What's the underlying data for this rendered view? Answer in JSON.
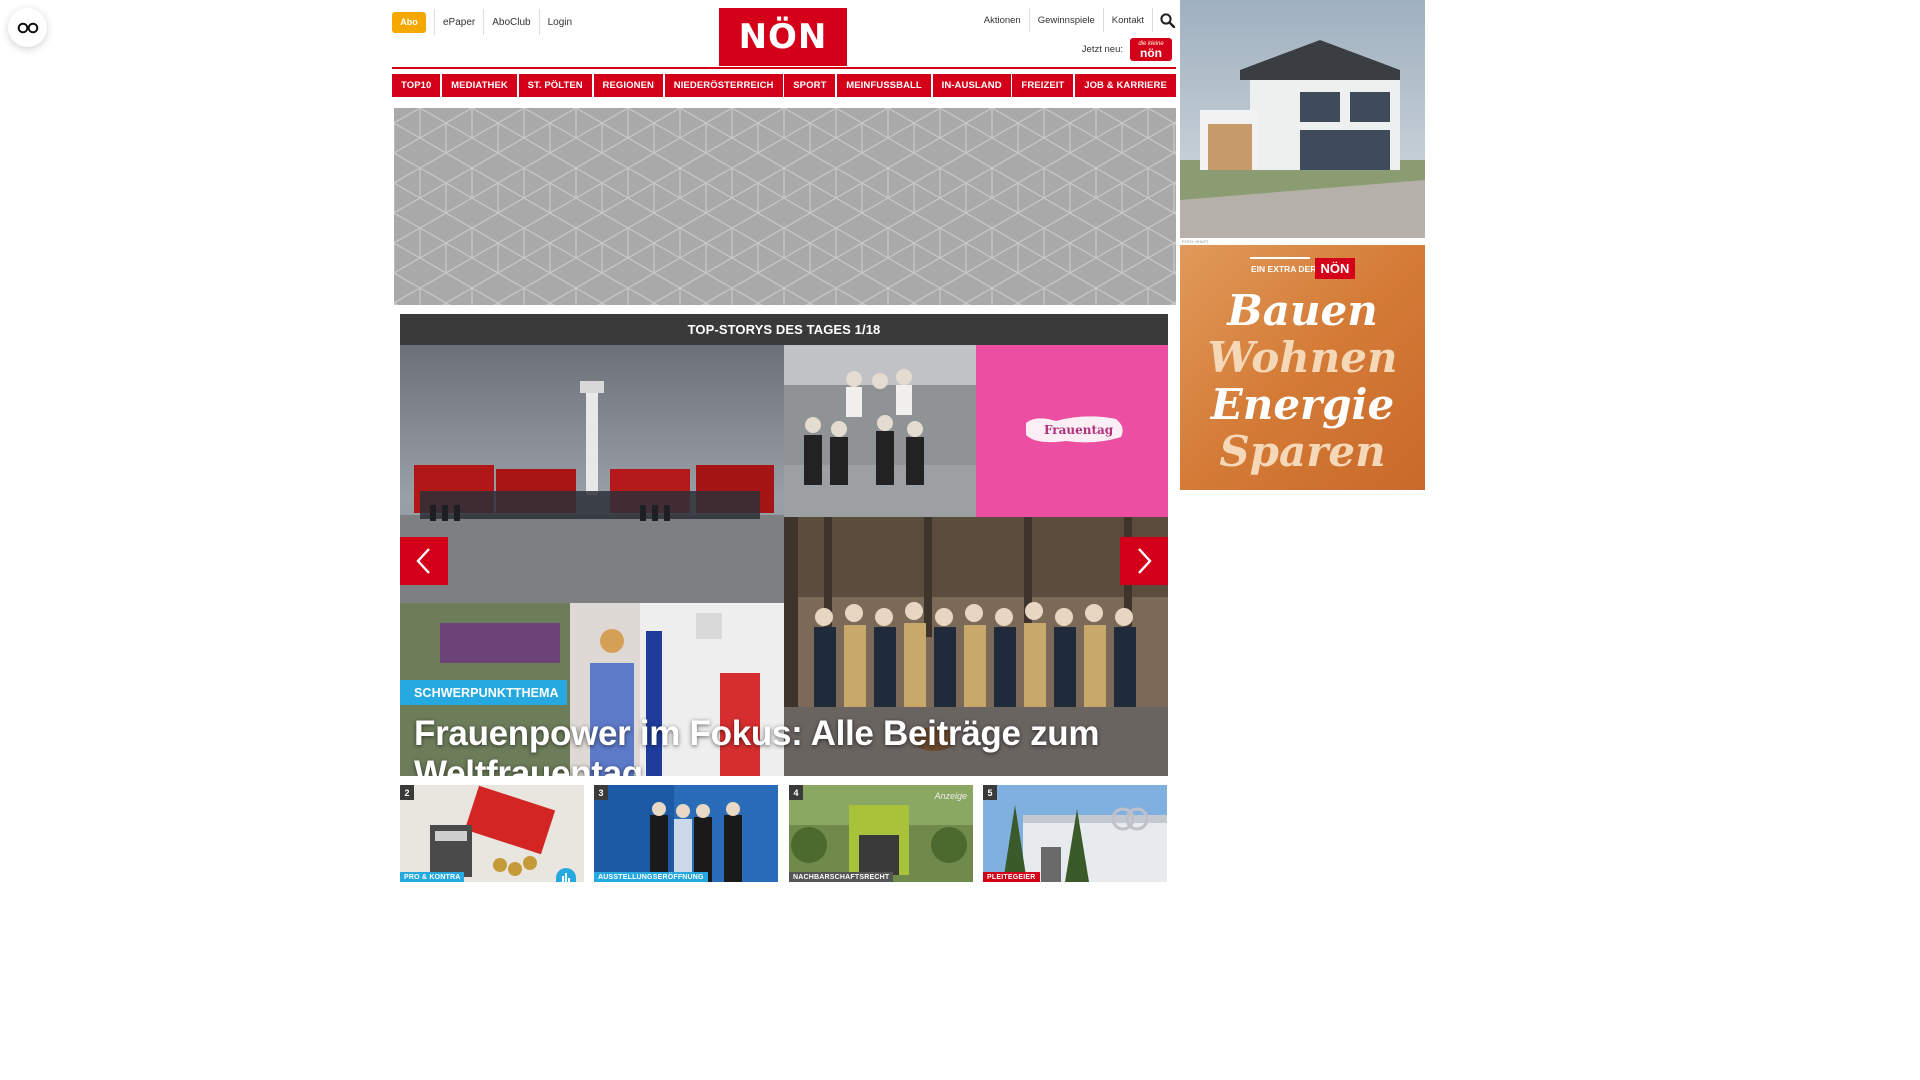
{
  "header": {
    "abo_label": "Abo",
    "top_links": [
      "ePaper",
      "AboClub",
      "Login"
    ],
    "logo_text": "NÖN",
    "right_links": [
      "Aktionen",
      "Gewinnspiele",
      "Kontakt"
    ],
    "jetzt_label": "Jetzt neu:",
    "jetzt_badge_text": "nön",
    "jetzt_badge_small": "die kleine"
  },
  "nav": {
    "items": [
      "TOP10",
      "MEDIATHEK",
      "ST. PÖLTEN",
      "REGIONEN",
      "NIEDERÖSTERREICH",
      "SPORT",
      "MEINFUSSBALL",
      "IN-AUSLAND",
      "FREIZEIT",
      "JOB & KARRIERE"
    ]
  },
  "stories": {
    "title": "TOP-STORYS DES TAGES 1/18",
    "tag": "SCHWERPUNKTTHEMA",
    "headline": "Frauenpower im Fokus: Alle Beiträge zum Weltfrauentag",
    "frauentag_label": "Frauentag"
  },
  "teasers": [
    {
      "num": "2",
      "tag": "PRO & KONTRA",
      "tag_color": "#26a9e0",
      "anzeige": ""
    },
    {
      "num": "3",
      "tag": "AUSSTELLUNGSERÖFFNUNG",
      "tag_color": "#26a9e0",
      "anzeige": ""
    },
    {
      "num": "4",
      "tag": "NACHBARSCHAFTSRECHT",
      "tag_color": "#555555",
      "anzeige": "Anzeige"
    },
    {
      "num": "5",
      "tag": "PLEITEGEIER",
      "tag_color": "#d4001a",
      "anzeige": ""
    }
  ],
  "sidebar": {
    "credit": "FOTO: SHUTT",
    "extra_label": "EIN EXTRA DER",
    "extra_logo": "NÖN",
    "words": [
      {
        "text": "Bauen",
        "color": "#ffffff"
      },
      {
        "text": "Wohnen",
        "color": "#f4d8b8"
      },
      {
        "text": "Energie",
        "color": "#ffffff"
      },
      {
        "text": "Sparen",
        "color": "#f4d8b8"
      }
    ]
  },
  "colors": {
    "brand_red": "#d4001a",
    "abo_orange": "#f5a800",
    "tag_blue": "#26a9e0",
    "header_dark": "#3a3a3a"
  },
  "icons": [
    "glasses-icon",
    "search-icon",
    "chevron-left-icon",
    "chevron-right-icon",
    "chart-icon"
  ]
}
